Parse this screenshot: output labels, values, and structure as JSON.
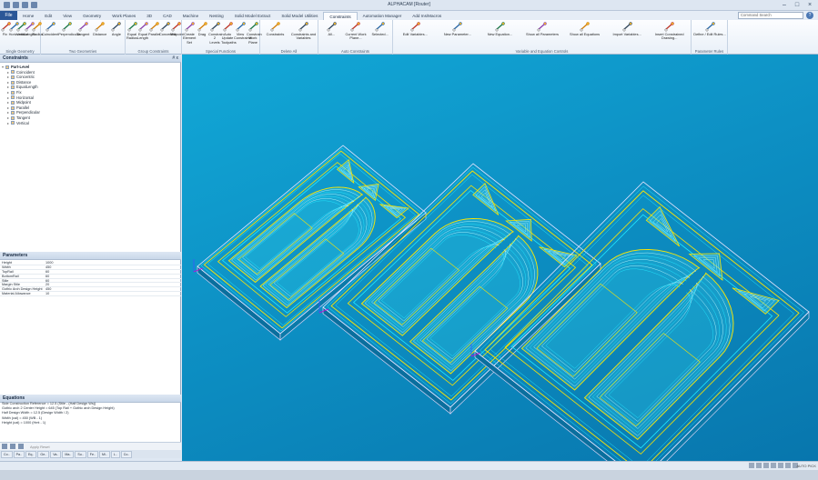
{
  "window": {
    "title": "ALPHACAM [Router]"
  },
  "menu": {
    "file": "File",
    "tabs": [
      "Home",
      "Edit",
      "View",
      "Geometry",
      "Work Planes",
      "3D",
      "CAD",
      "Machine",
      "Nesting",
      "Solid Model Extract",
      "Solid Model Utilities",
      "Constraints",
      "Automation Manager",
      "Add Ins/Macros"
    ],
    "active_tab": "Constraints",
    "search_placeholder": "Command Search",
    "help": "?"
  },
  "ribbon": {
    "groups": [
      {
        "label": "Single Geometry",
        "buttons": [
          "Fix",
          "Horizontal",
          "Vertical",
          "Length",
          "Radius"
        ]
      },
      {
        "label": "Two Geometries",
        "buttons": [
          "Coincident",
          "Perpendicular",
          "Tangent",
          "Distance",
          "Angle"
        ]
      },
      {
        "label": "Group Constraints",
        "buttons": [
          "Equal Radius",
          "Equal Length",
          "Parallel",
          "Concentric",
          "Midpoint"
        ]
      },
      {
        "label": "Special Functions",
        "buttons": [
          "Create Element Set",
          "Drag",
          "Constrain 2 Levels",
          "Auto Update Toolpaths",
          "View Constraints",
          "Constrain Work Plane"
        ]
      },
      {
        "label": "Delete All",
        "buttons": [
          "Constraints",
          "Constraints and Variables"
        ]
      },
      {
        "label": "Auto Constraints",
        "buttons": [
          "All...",
          "Current Work Plane...",
          "Selected..."
        ]
      },
      {
        "label": "Variable and Equation Controls",
        "buttons": [
          "Edit Variables...",
          "New Parameter...",
          "New Equation...",
          "Show all Parameters",
          "Show all Equations",
          "Import Variables...",
          "Insert Constrained Drawing..."
        ]
      },
      {
        "label": "Parameter Rules",
        "buttons": [
          "Define / Edit Rules..."
        ]
      }
    ]
  },
  "constraints_panel": {
    "title": "Constraints",
    "pin": "# x",
    "root": "Part-Level",
    "items": [
      "Coincident",
      "Concentric",
      "Distance",
      "EqualLength",
      "Fix",
      "Horizontal",
      "Midpoint",
      "Parallel",
      "Perpendicular",
      "Tangent",
      "Vertical"
    ]
  },
  "parameters_panel": {
    "title": "Parameters",
    "rows": [
      {
        "name": "Height",
        "value": "1000"
      },
      {
        "name": "Width",
        "value": "450"
      },
      {
        "name": "TopRail",
        "value": "60"
      },
      {
        "name": "BottomRail",
        "value": "60"
      },
      {
        "name": "Stile",
        "value": "60"
      },
      {
        "name": "Margin Stile",
        "value": "20"
      },
      {
        "name": "Gothic Arch Design Height",
        "value": "450"
      },
      {
        "name": "Material Allowance",
        "value": "10"
      }
    ]
  },
  "equations_panel": {
    "title": "Equations",
    "rows": [
      "Side Construction Reference   = 12.5 (Stile - (Half Design Ws))",
      "Gothic arch 2 Center Height   = 645 (Top Rail + Gothic arch Design Height)",
      "Half Design Width             = 12.5 (Design Width / 2)",
      "Width (cal)                   = 450 (WB - 1)",
      "Height (cal)                  = 1000 (Hmt - 1)"
    ],
    "apply_label": "Apply   Reset"
  },
  "panel_tabs": [
    "Co..",
    "Pa..",
    "Eq..",
    "Ge..",
    "Va..",
    "Ma..",
    "Su..",
    "Fe..",
    "Mi..",
    "L..",
    "Co.."
  ],
  "statusbar": {
    "right_text": "AUTO   PICK"
  }
}
